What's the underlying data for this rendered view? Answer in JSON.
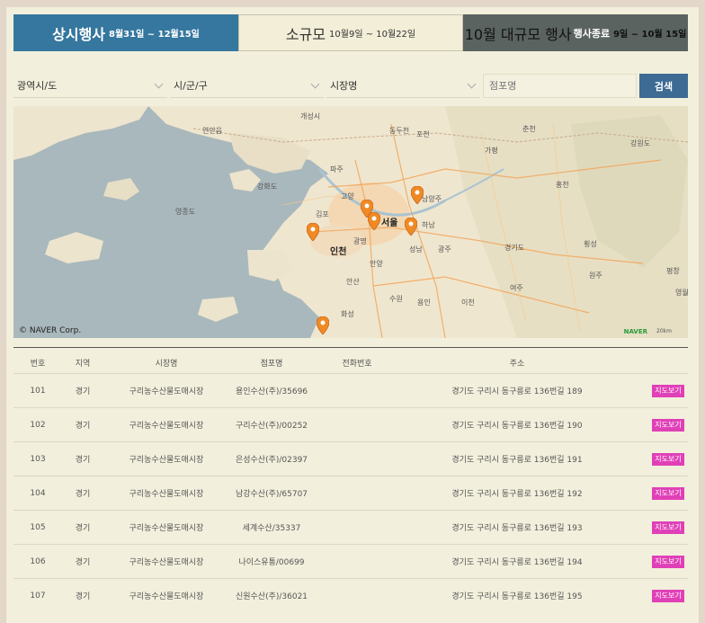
{
  "tabs": [
    {
      "title": "상시행사",
      "dates": "8월31일 ~ 12월15일"
    },
    {
      "title": "소규모",
      "dates": "10월9일 ~ 10월22일"
    },
    {
      "title": "10월 대규모 행사",
      "badge": "행사종료",
      "dates": "9일 ~ 10월 15일"
    }
  ],
  "filters": {
    "province": "광역시/도",
    "district": "시/군/구",
    "market": "시장명",
    "store_placeholder": "점포명",
    "search_label": "검색"
  },
  "map": {
    "copyright": "© NAVER Corp.",
    "brand": "NAVER",
    "scale": "20km",
    "labels": {
      "seoul": "서울",
      "incheon": "인천",
      "gyeonggi": "경기도",
      "gangwon": "강원도",
      "dongducheon": "동두천",
      "pocheon": "포천",
      "gapyeong": "가평",
      "chuncheon": "춘천",
      "hongcheon": "홍천",
      "paju": "파주",
      "goyang": "고양",
      "gimpo": "김포",
      "namyangju": "남양주",
      "hanam": "하남",
      "gwangmyeong": "광명",
      "seongnam": "성남",
      "gwangju": "광주",
      "ansan": "안산",
      "suwon": "수원",
      "yongin": "용인",
      "icheon": "이천",
      "yeoju": "여주",
      "wonju": "원주",
      "hwaseong": "화성",
      "hoengseong": "횡성",
      "pyeongchang": "평창",
      "yeongwol": "영월",
      "gaeseong": "개성시",
      "yeonan": "연안읍",
      "ganghwa": "강화도",
      "yeongjong": "영종도",
      "anyang": "안양"
    }
  },
  "table": {
    "headers": [
      "번호",
      "지역",
      "시장명",
      "점포명",
      "전화번호",
      "주소"
    ],
    "map_button": "지도보기",
    "rows": [
      {
        "no": "101",
        "region": "경기",
        "market": "구리농수산물도매시장",
        "store": "용인수산(주)/35696",
        "phone": "",
        "address": "경기도 구리시 동구릉로 136번길 189"
      },
      {
        "no": "102",
        "region": "경기",
        "market": "구리농수산물도매시장",
        "store": "구리수산(주)/00252",
        "phone": "",
        "address": "경기도 구리시 동구릉로 136번길 190"
      },
      {
        "no": "103",
        "region": "경기",
        "market": "구리농수산물도매시장",
        "store": "은성수산(주)/02397",
        "phone": "",
        "address": "경기도 구리시 동구릉로 136번길 191"
      },
      {
        "no": "104",
        "region": "경기",
        "market": "구리농수산물도매시장",
        "store": "남강수산(주)/65707",
        "phone": "",
        "address": "경기도 구리시 동구릉로 136번길 192"
      },
      {
        "no": "105",
        "region": "경기",
        "market": "구리농수산물도매시장",
        "store": "세계수산/35337",
        "phone": "",
        "address": "경기도 구리시 동구릉로 136번길 193"
      },
      {
        "no": "106",
        "region": "경기",
        "market": "구리농수산물도매시장",
        "store": "나이스유통/00699",
        "phone": "",
        "address": "경기도 구리시 동구릉로 136번길 194"
      },
      {
        "no": "107",
        "region": "경기",
        "market": "구리농수산물도매시장",
        "store": "신원수산(주)/36021",
        "phone": "",
        "address": "경기도 구리시 동구릉로 136번길 195"
      }
    ]
  },
  "colors": {
    "tab_active": "#35779e",
    "tab_closed": "#5a6360",
    "search_button": "#3d6b93",
    "map_button": "#e040b7",
    "pin": "#f08a24"
  }
}
